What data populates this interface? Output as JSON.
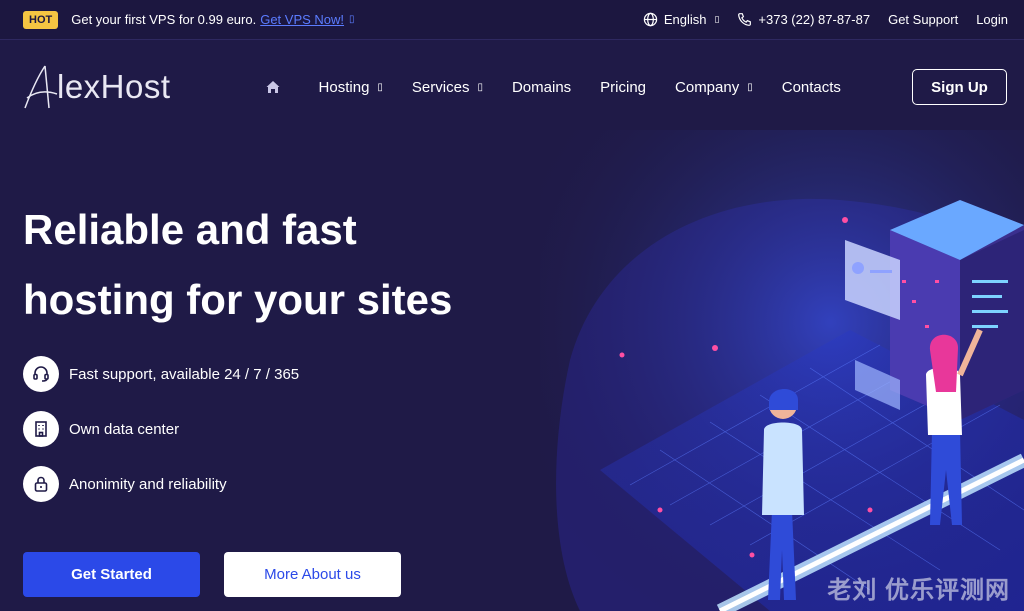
{
  "topbar": {
    "hot_badge": "HOT",
    "promo_text": "Get your first VPS for 0.99 euro.",
    "promo_link": "Get VPS Now!",
    "language": "English",
    "phone": "+373 (22) 87-87-87",
    "support": "Get Support",
    "login": "Login"
  },
  "header": {
    "logo": "lexHost",
    "nav": [
      {
        "label": "Hosting",
        "dropdown": true
      },
      {
        "label": "Services",
        "dropdown": true
      },
      {
        "label": "Domains",
        "dropdown": false
      },
      {
        "label": "Pricing",
        "dropdown": false
      },
      {
        "label": "Company",
        "dropdown": true
      },
      {
        "label": "Contacts",
        "dropdown": false
      }
    ],
    "signup": "Sign Up"
  },
  "hero": {
    "title_line1": "Reliable and fast",
    "title_line2": "hosting for your sites",
    "features": [
      {
        "icon": "headset-icon",
        "text": "Fast support, available 24 / 7 / 365"
      },
      {
        "icon": "building-icon",
        "text": "Own data center"
      },
      {
        "icon": "lock-icon",
        "text": "Anonimity and reliability"
      }
    ],
    "primary_button": "Get Started",
    "secondary_button": "More About us"
  },
  "watermark": "老刘 优乐评测网",
  "colors": {
    "background": "#1f1a47",
    "accent": "#2b49e8",
    "hot": "#f5c542",
    "link": "#5b7cff"
  }
}
